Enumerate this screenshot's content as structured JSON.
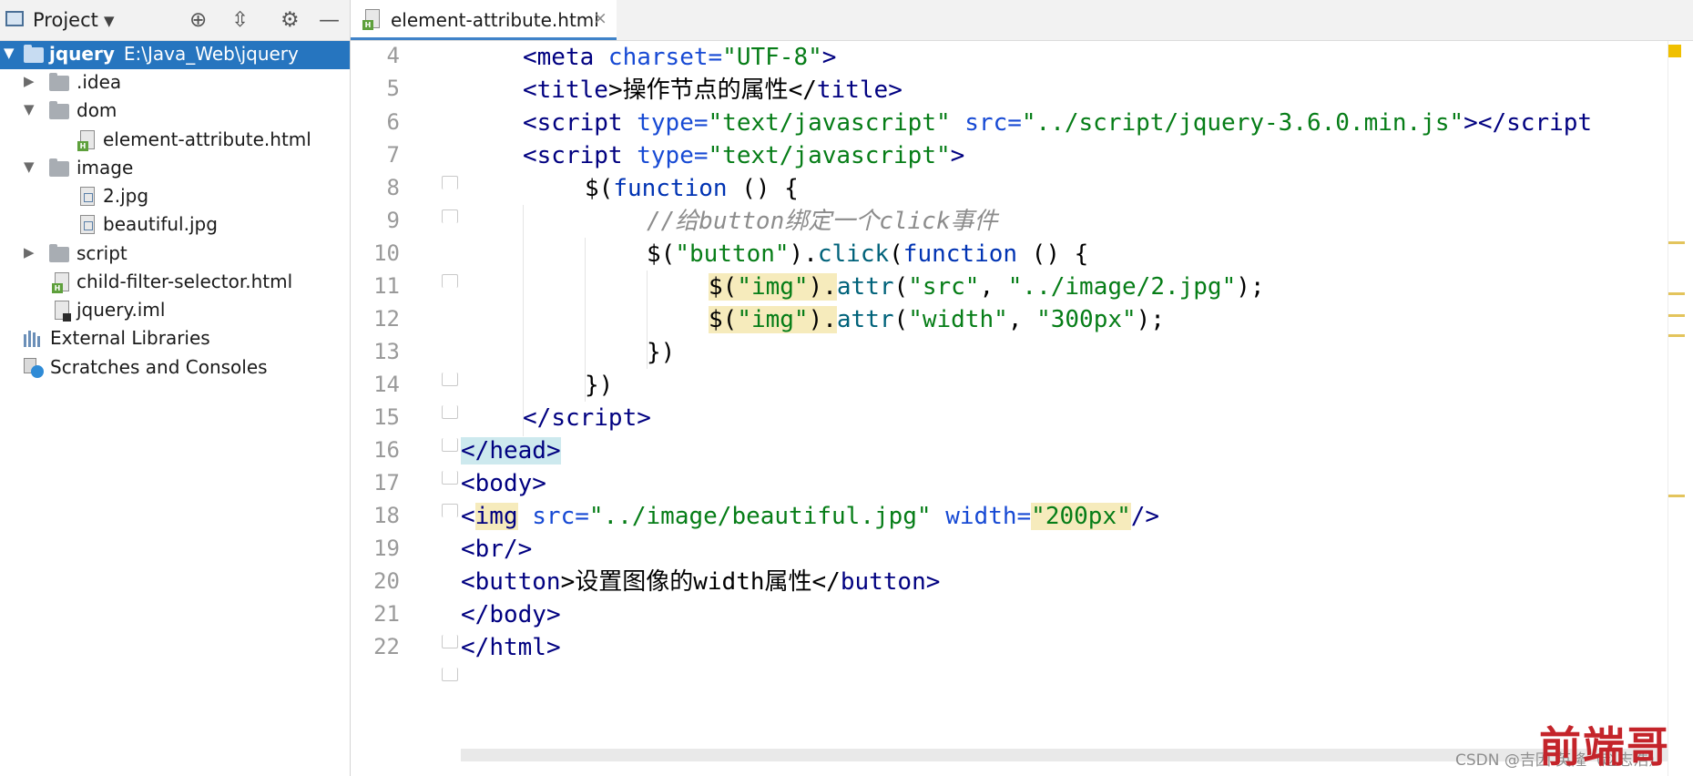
{
  "project_panel": {
    "title": "Project",
    "header_buttons": [
      "locate-icon",
      "collapse-icon",
      "gear-icon",
      "minimize-icon"
    ],
    "tree": [
      {
        "name": "jquery",
        "path": "E:\\Java_Web\\jquery",
        "type": "root-folder",
        "expanded": true,
        "selected": true
      },
      {
        "name": ".idea",
        "type": "folder",
        "expanded": false
      },
      {
        "name": "dom",
        "type": "folder",
        "expanded": true
      },
      {
        "name": "element-attribute.html",
        "type": "html-file"
      },
      {
        "name": "image",
        "type": "folder",
        "expanded": true
      },
      {
        "name": "2.jpg",
        "type": "image-file"
      },
      {
        "name": "beautiful.jpg",
        "type": "image-file"
      },
      {
        "name": "script",
        "type": "folder",
        "expanded": false
      },
      {
        "name": "child-filter-selector.html",
        "type": "html-file"
      },
      {
        "name": "jquery.iml",
        "type": "iml-file"
      },
      {
        "name": "External Libraries",
        "type": "libraries"
      },
      {
        "name": "Scratches and Consoles",
        "type": "scratches"
      }
    ]
  },
  "editor": {
    "tab_label": "element-attribute.html",
    "tab_close": "×",
    "line_numbers": [
      "4",
      "5",
      "6",
      "7",
      "8",
      "9",
      "10",
      "11",
      "12",
      "13",
      "14",
      "15",
      "16",
      "17",
      "18",
      "19",
      "20",
      "21",
      "22"
    ],
    "lines": [
      {
        "a": "<",
        "b": "meta",
        "c": " charset",
        "d": "=",
        "e": "\"UTF-8\"",
        "f": ">"
      },
      {
        "a": "<",
        "b": "title",
        "c": ">操作节点的属性</",
        "d": "title",
        "e": ">"
      },
      {
        "a": "<",
        "b": "script",
        "c": " type",
        "d": "=",
        "e": "\"text/javascript\"",
        "f": " src",
        "g": "=",
        "h": "\"../script/jquery-3.6.0.min.js\"",
        "i": "></",
        "j": "script"
      },
      {
        "a": "<",
        "b": "script",
        "c": " type",
        "d": "=",
        "e": "\"text/javascript\"",
        "f": ">"
      },
      {
        "a": "$(",
        "b": "function",
        "c": " () {"
      },
      {
        "a": "//给button绑定一个click事件"
      },
      {
        "a": "$(",
        "b": "\"button\"",
        "c": ").",
        "d": "click",
        "e": "(",
        "f": "function",
        "g": " () {"
      },
      {
        "a": "$(",
        "b": "\"img\"",
        "c": ").",
        "d": "attr",
        "e": "(",
        "f": "\"src\"",
        "g": ", ",
        "h": "\"../image/2.jpg\"",
        "i": ");"
      },
      {
        "a": "$(",
        "b": "\"img\"",
        "c": ").",
        "d": "attr",
        "e": "(",
        "f": "\"width\"",
        "g": ", ",
        "h": "\"300px\"",
        "i": ");"
      },
      {
        "a": "})"
      },
      {
        "a": "})"
      },
      {
        "a": "</",
        "b": "script",
        "c": ">"
      },
      {
        "a": "</",
        "b": "head",
        "c": ">"
      },
      {
        "a": "<",
        "b": "body",
        "c": ">"
      },
      {
        "a": "<",
        "b": "img",
        "c": " src",
        "d": "=",
        "e": "\"../image/beautiful.jpg\"",
        "f": " width",
        "g": "=",
        "h": "\"200px\"",
        "i": "/>"
      },
      {
        "a": "<",
        "b": "br",
        "c": "/>"
      },
      {
        "a": "<",
        "b": "button",
        "c": ">设置图像的width属性</",
        "d": "button",
        "e": ">"
      },
      {
        "a": "</",
        "b": "body",
        "c": ">"
      },
      {
        "a": "</",
        "b": "html",
        "c": ">"
      }
    ]
  },
  "watermarks": {
    "csdn": "CSDN @吉因 英隆（赵志浩）",
    "logo": "前端哥"
  },
  "colors": {
    "selection": "#2675bf",
    "tag": "#000080",
    "attr_name": "#174ad4",
    "string": "#067d17",
    "comment": "#8c8c8c",
    "function_call": "#00627a",
    "keyword": "#0033b3",
    "usage_highlight": "#f6ebbc",
    "brace_highlight": "#cde9ee"
  }
}
